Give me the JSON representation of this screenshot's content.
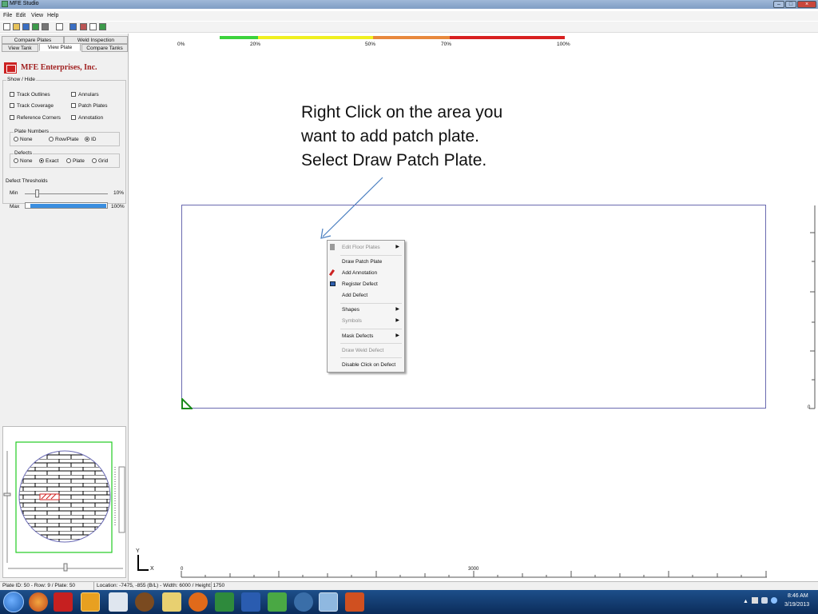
{
  "window": {
    "title": "MFE Studio"
  },
  "menu": [
    "File",
    "Edit",
    "View",
    "Help"
  ],
  "tabs": {
    "compare_plates": "Compare Plates",
    "weld_inspection": "Weld Inspection",
    "view_tank": "View Tank",
    "view_plate": "View Plate",
    "compare_tanks": "Compare Tanks"
  },
  "company": "MFE Enterprises, Inc.",
  "show_hide": {
    "label": "Show / Hide",
    "track_outlines": "Track Outlines",
    "annulars": "Annulars",
    "track_coverage": "Track Coverage",
    "patch_plates": "Patch Plates",
    "reference_corners": "Reference Corners",
    "annotation": "Annotation"
  },
  "plate_numbers": {
    "label": "Plate Numbers",
    "none": "None",
    "row_plate": "Row/Plate",
    "id": "ID",
    "selected": "ID"
  },
  "defects": {
    "label": "Defects",
    "none": "None",
    "exact": "Exact",
    "plate": "Plate",
    "grid": "Grid",
    "selected": "Exact"
  },
  "thresholds": {
    "label": "Defect Thresholds",
    "min_label": "Min",
    "min_value": "10%",
    "max_label": "Max",
    "max_value": "100%"
  },
  "scale": {
    "p0": "0%",
    "p20": "20%",
    "p50": "50%",
    "p70": "70%",
    "p100": "100%"
  },
  "colors": {
    "green": "#3cd23c",
    "yellow": "#f0f020",
    "orange": "#e8883c",
    "red": "#d82020",
    "accent": "#3a8ee0"
  },
  "callout": "Right Click on the area you want to add patch plate.  Select Draw Patch Plate.",
  "context_menu": {
    "edit_floor_plates": "Edit Floor Plates",
    "draw_patch_plate": "Draw Patch Plate",
    "add_annotation": "Add Annotation",
    "register_defect": "Register Defect",
    "add_defect": "Add Defect",
    "shapes": "Shapes",
    "symbols": "Symbols",
    "mask_defects": "Mask Defects",
    "draw_weld_defect": "Draw Weld Defect",
    "disable_click_on_defect": "Disable Click on Defect"
  },
  "axis": {
    "y": "Y",
    "x": "X",
    "x0": "0",
    "x_mid": "3000",
    "right0": "0"
  },
  "status": {
    "plate_info": "Plate ID: 50 - Row: 9 / Plate: 50",
    "location": "Location: -7475, -855 (B/L) - Width: 6000 / Height: 1750"
  },
  "clock": {
    "time": "8:46 AM",
    "date": "3/19/2013"
  }
}
